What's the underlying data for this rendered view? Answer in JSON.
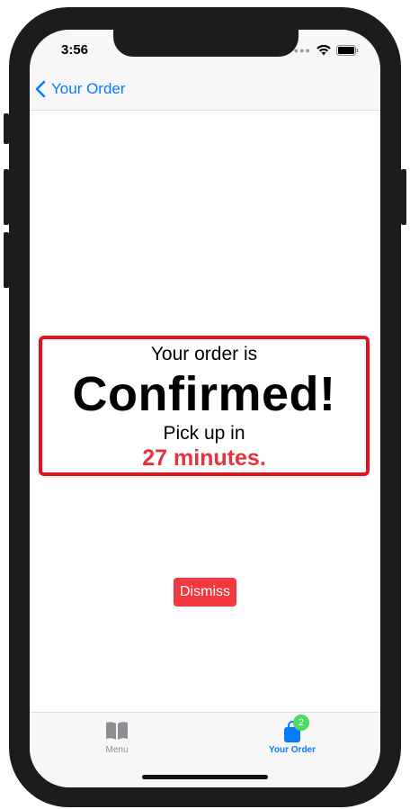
{
  "status_bar": {
    "time": "3:56",
    "signal_icon": "signal-dots-icon",
    "wifi_icon": "wifi-icon",
    "battery_icon": "battery-icon"
  },
  "nav": {
    "back_label": "Your Order",
    "back_icon": "chevron-left-icon"
  },
  "confirmation": {
    "line1": "Your order is",
    "headline": "Confirmed!",
    "line3": "Pick up in",
    "eta": "27 minutes.",
    "border_color": "#e8111b",
    "eta_color": "#e8323a"
  },
  "dismiss_button": {
    "label": "Dismiss",
    "color": "#f2393f"
  },
  "tab_bar": {
    "items": [
      {
        "label": "Menu",
        "icon": "book-icon",
        "active": false
      },
      {
        "label": "Your Order",
        "icon": "shopping-bag-icon",
        "active": true,
        "badge": "2"
      }
    ],
    "active_color": "#0a7bff",
    "badge_color": "#4cd964"
  }
}
